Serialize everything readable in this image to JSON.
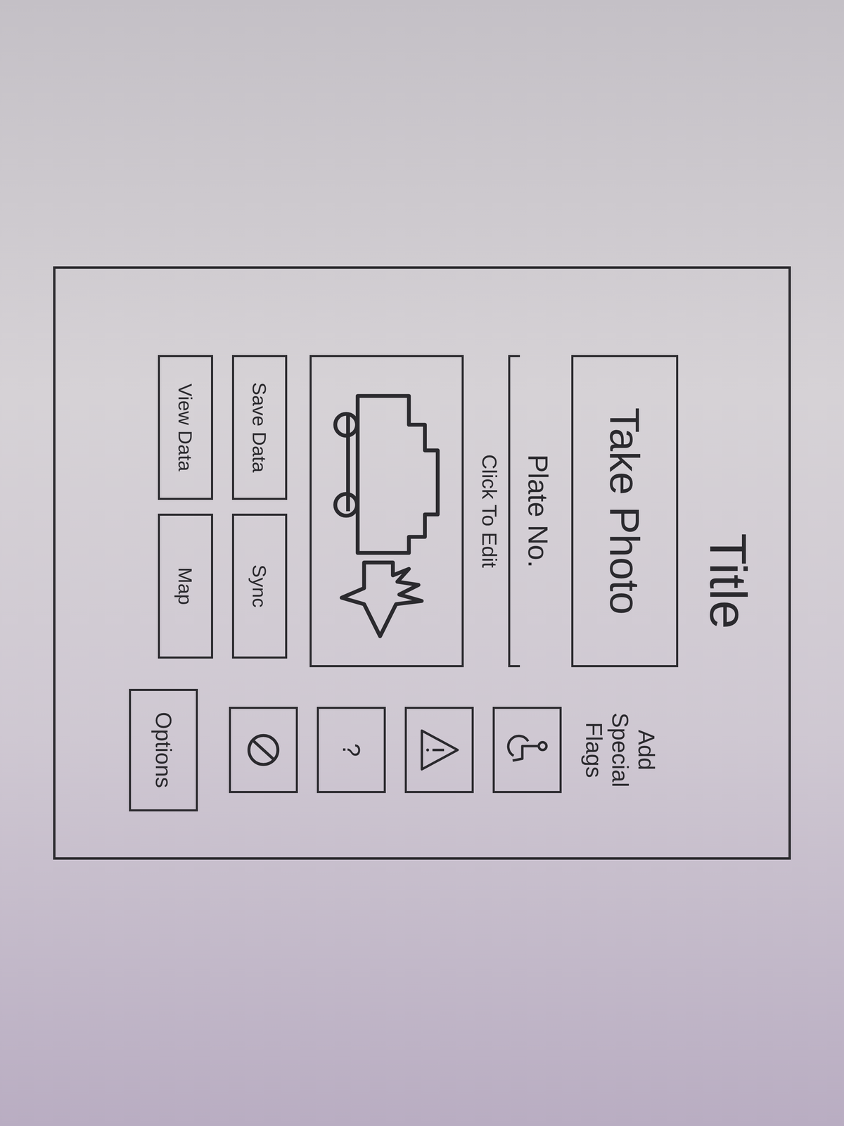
{
  "window": {
    "title": "Title"
  },
  "take_photo_button": "Take Photo",
  "plate_field": {
    "label": "Plate No.",
    "hint": "Click To Edit"
  },
  "flags": {
    "label": "Add Special Flags",
    "items": [
      {
        "kind": "wheelchair"
      },
      {
        "kind": "warning"
      },
      {
        "kind": "glyph",
        "glyph": "?"
      },
      {
        "kind": "no-entry"
      }
    ]
  },
  "action_rows": [
    [
      "Save Data",
      "Sync"
    ],
    [
      "View Data",
      "Map"
    ]
  ],
  "options_button": "Options"
}
